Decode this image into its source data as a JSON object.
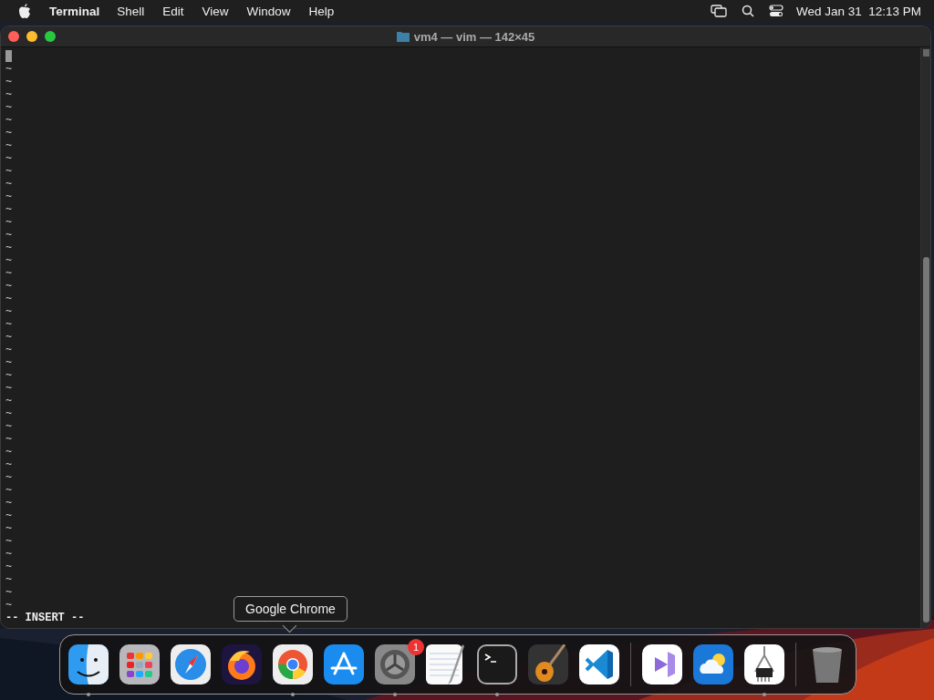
{
  "menu_bar": {
    "app_name": "Terminal",
    "menus": [
      "Shell",
      "Edit",
      "View",
      "Window",
      "Help"
    ],
    "clock": "Wed Jan 31  12:13 PM"
  },
  "window": {
    "title": "vm4 — vim — 142×45"
  },
  "editor": {
    "lines": [
      "~",
      "~",
      "~",
      "~",
      "~",
      "~",
      "~",
      "~",
      "~",
      "~",
      "~",
      "~",
      "~",
      "~",
      "~",
      "~",
      "~",
      "~",
      "~",
      "~",
      "~",
      "~",
      "~",
      "~",
      "~",
      "~",
      "~",
      "~",
      "~",
      "~",
      "~",
      "~",
      "~",
      "~",
      "~",
      "~",
      "~",
      "~",
      "~",
      "~",
      "~",
      "~",
      "~"
    ],
    "mode": "-- INSERT --"
  },
  "tooltip": {
    "text": "Google Chrome"
  },
  "dock": {
    "items": [
      {
        "kind": "app",
        "running": true
      },
      {
        "kind": "app",
        "running": false
      },
      {
        "kind": "app",
        "running": false
      },
      {
        "kind": "app",
        "running": false
      },
      {
        "kind": "app",
        "running": true
      },
      {
        "kind": "app",
        "running": false
      },
      {
        "kind": "app",
        "running": true,
        "badge": "1"
      },
      {
        "kind": "app",
        "running": false
      },
      {
        "kind": "app",
        "running": true
      },
      {
        "kind": "app",
        "running": false
      },
      {
        "kind": "app",
        "running": false
      },
      {
        "kind": "separator"
      },
      {
        "kind": "app",
        "running": false
      },
      {
        "kind": "app",
        "running": false
      },
      {
        "kind": "app",
        "running": true
      },
      {
        "kind": "separator"
      },
      {
        "kind": "app",
        "running": false
      }
    ]
  }
}
